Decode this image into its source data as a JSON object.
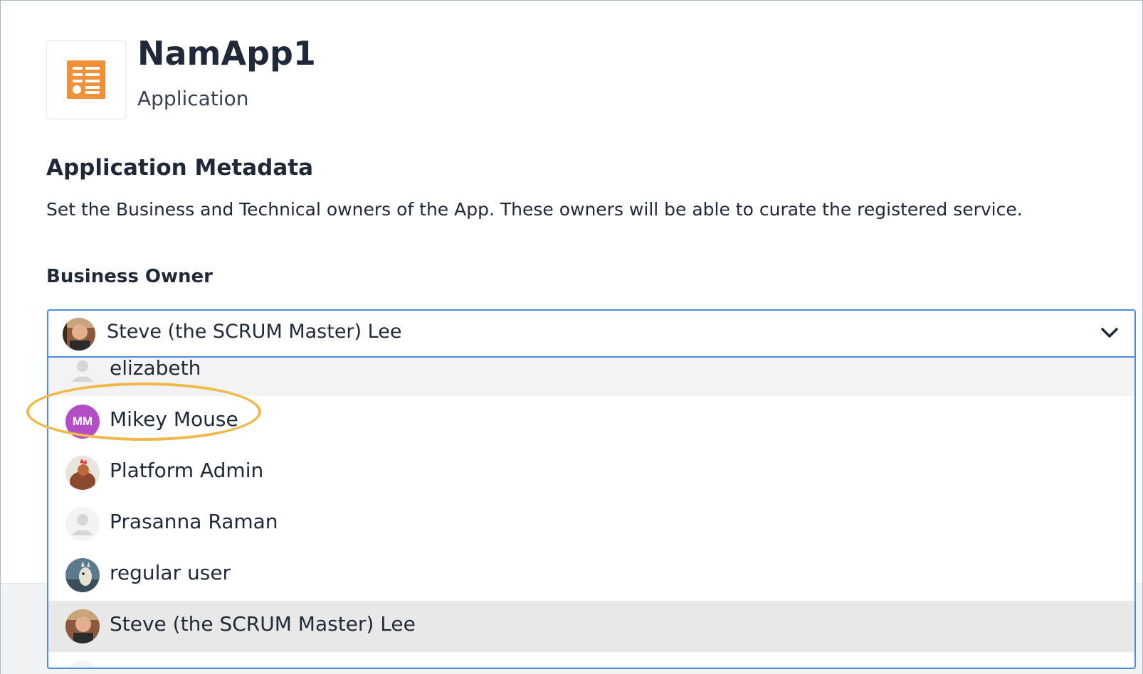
{
  "header": {
    "title": "NamApp1",
    "subtitle": "Application",
    "icon": "application-list-icon",
    "icon_color": "#f0913a"
  },
  "section": {
    "title": "Application Metadata",
    "description": "Set the Business and Technical owners of the App. These owners will be able to curate the registered service."
  },
  "business_owner": {
    "label": "Business Owner",
    "selected": "Steve (the SCRUM Master) Lee",
    "options": [
      {
        "name": "elizabeth",
        "avatar": "default-user-avatar"
      },
      {
        "name": "Mikey Mouse",
        "avatar": "initials-avatar",
        "initials": "MM",
        "avatar_color": "#b44ec7",
        "highlighted": true
      },
      {
        "name": "Platform Admin",
        "avatar": "rooster-photo-avatar"
      },
      {
        "name": "Prasanna Raman",
        "avatar": "default-user-avatar"
      },
      {
        "name": "regular user",
        "avatar": "llama-photo-avatar"
      },
      {
        "name": "Steve (the SCRUM Master) Lee",
        "avatar": "person-photo-avatar",
        "selected": true
      }
    ]
  },
  "colors": {
    "accent": "#4a90d9",
    "highlight_ring": "#eeb94a",
    "selected_row": "#e8e8e8"
  }
}
